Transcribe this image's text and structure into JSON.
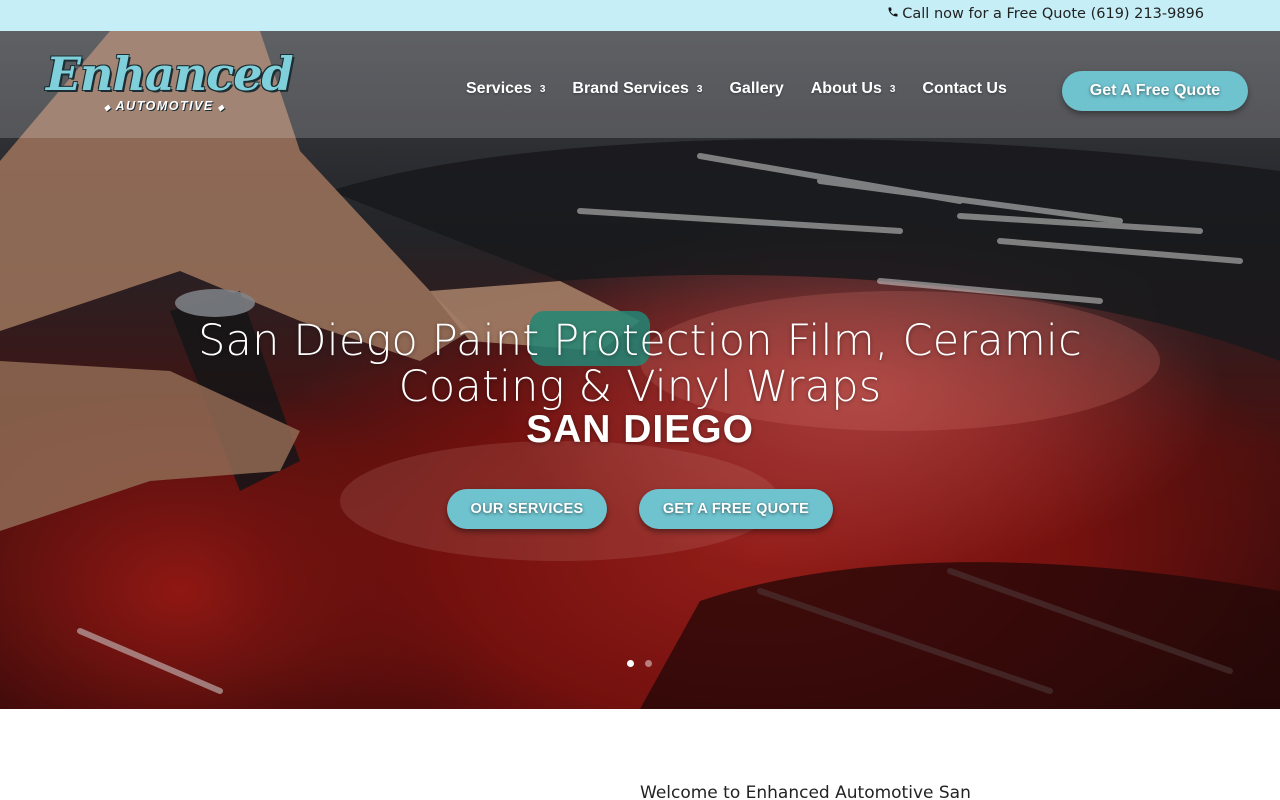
{
  "topbar": {
    "call_text": "Call now for a Free Quote (619) 213-9896",
    "icon": "phone-icon"
  },
  "logo": {
    "word": "Enhanced",
    "sub": "AUTOMOTIVE"
  },
  "nav": {
    "items": [
      {
        "label": "Services",
        "has_dropdown": true
      },
      {
        "label": "Brand Services",
        "has_dropdown": true
      },
      {
        "label": "Gallery",
        "has_dropdown": false
      },
      {
        "label": "About Us",
        "has_dropdown": true
      },
      {
        "label": "Contact Us",
        "has_dropdown": false
      }
    ],
    "dropdown_glyph": "3",
    "quote_button": "Get A Free Quote"
  },
  "hero": {
    "headline_line1": "San Diego Paint Protection Film, Ceramic",
    "headline_line2": "Coating & Vinyl Wraps",
    "subhead": "SAN DIEGO",
    "cta_services": "OUR SERVICES",
    "cta_quote": "GET A FREE QUOTE",
    "slides": 2,
    "active_slide": 1
  },
  "content": {
    "welcome": "Welcome to Enhanced Automotive San"
  },
  "colors": {
    "topbar_bg": "#c6eef6",
    "accent": "#6fc3cf",
    "logo_teal": "#7fd0da"
  }
}
